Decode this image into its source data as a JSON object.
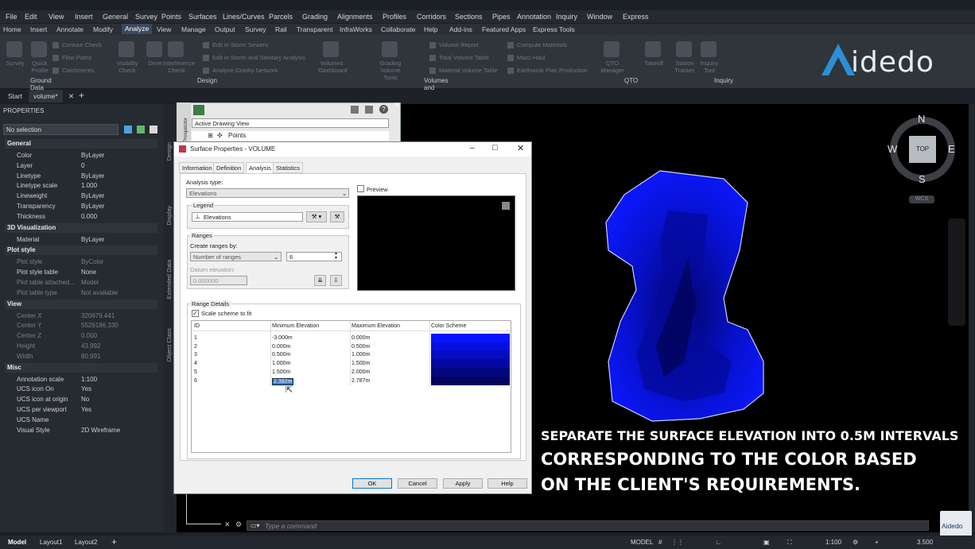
{
  "menu": [
    "File",
    "Edit",
    "View",
    "Insert",
    "General",
    "Survey",
    "Points",
    "Surfaces",
    "Lines/Curves",
    "Parcels",
    "Grading",
    "Alignments",
    "Profiles",
    "Corridors",
    "Sections",
    "Pipes",
    "Annotation",
    "Inquiry",
    "Window",
    "Express"
  ],
  "ribbon_tabs": [
    "Home",
    "Insert",
    "Annotate",
    "Modify",
    "Analyze",
    "View",
    "Manage",
    "Output",
    "Survey",
    "Rail",
    "Transparent",
    "InfraWorks",
    "Collaborate",
    "Help",
    "Add-ins",
    "Featured Apps",
    "Express Tools"
  ],
  "ribbon": {
    "big": [
      "Survey",
      "Quick Profile",
      "Visibility Check",
      "Drive",
      "Interference Check",
      "Volumes Dashboard",
      "Grading Volume Tools",
      "QTO Manager",
      "Takeoff",
      "Station Tracker",
      "Inquiry Tool"
    ],
    "small": [
      "Contour Check",
      "Flow Paths",
      "Catchments",
      "Edit in Storm Sewers",
      "Edit in Storm and Sanitary Analysis",
      "Analyze Gravity Network",
      "Volume Report",
      "Total Volume Table",
      "Material Volume Table",
      "Compute Materials",
      "Mass Haul",
      "Earthwork Plan Production"
    ],
    "groups": [
      "Ground Data",
      "Design",
      "Volumes and Materials",
      "QTO",
      "Inquiry"
    ]
  },
  "logo": "idedo",
  "doc_tabs": [
    "Start",
    "volume*"
  ],
  "properties": {
    "title": "PROPERTIES",
    "selection": "No selection",
    "sections": {
      "general": "General",
      "viz": "3D Visualization",
      "plot": "Plot style",
      "view": "View",
      "misc": "Misc"
    },
    "general": [
      [
        "Color",
        "ByLayer"
      ],
      [
        "Layer",
        "0"
      ],
      [
        "Linetype",
        "ByLayer"
      ],
      [
        "Linetype scale",
        "1.000"
      ],
      [
        "Lineweight",
        "ByLayer"
      ],
      [
        "Transparency",
        "ByLayer"
      ],
      [
        "Thickness",
        "0.000"
      ]
    ],
    "viz": [
      [
        "Material",
        "ByLayer"
      ]
    ],
    "plot": [
      [
        "Plot style",
        "ByColor"
      ],
      [
        "Plot style table",
        "None"
      ],
      [
        "Plot table attached...",
        "Model"
      ],
      [
        "Plot table type",
        "Not available"
      ]
    ],
    "view": [
      [
        "Center X",
        "320679.441"
      ],
      [
        "Center Y",
        "5526186.330"
      ],
      [
        "Center Z",
        "0.000"
      ],
      [
        "Height",
        "43.992"
      ],
      [
        "Width",
        "80.991"
      ]
    ],
    "misc": [
      [
        "Annotation scale",
        "1:100"
      ],
      [
        "UCS icon On",
        "Yes"
      ],
      [
        "UCS icon at origin",
        "No"
      ],
      [
        "UCS per viewport",
        "Yes"
      ],
      [
        "UCS Name",
        ""
      ],
      [
        "Visual Style",
        "2D Wireframe"
      ]
    ]
  },
  "side_tabs": [
    "Design",
    "Display",
    "Extended Data",
    "Object Class"
  ],
  "toolspace": {
    "view": "Active Drawing View",
    "item": "Points",
    "side": "Prospector"
  },
  "dialog": {
    "title": "Surface Properties - VOLUME",
    "tabs": [
      "Information",
      "Definition",
      "Analysis",
      "Statistics"
    ],
    "analysis_type_label": "Analysis type:",
    "analysis_type": "Elevations",
    "legend_label": "Legend",
    "legend": "Elevations",
    "preview": "Preview",
    "ranges_label": "Ranges",
    "create_by_label": "Create ranges by:",
    "create_by": "Number of ranges",
    "num_ranges": "6",
    "datum_label": "Datum elevation:",
    "datum": "0.000000",
    "details_label": "Range Details",
    "scale_scheme": "Scale scheme to fit",
    "columns": [
      "ID",
      "Minimum Elevation",
      "Maximum Elevation",
      "Color Scheme"
    ],
    "rows": [
      [
        "1",
        "-3.000m",
        "0.000m"
      ],
      [
        "2",
        "0.000m",
        "0.500m"
      ],
      [
        "3",
        "0.500m",
        "1.000m"
      ],
      [
        "4",
        "1.000m",
        "1.500m"
      ],
      [
        "5",
        "1.500m",
        "2.000m"
      ],
      [
        "6",
        "2.392m",
        "2.787m"
      ]
    ],
    "buttons": [
      "OK",
      "Cancel",
      "Apply",
      "Help"
    ]
  },
  "colors": {
    "scheme": [
      "#0a14ff",
      "#0810e0",
      "#060cc0",
      "#0508a0",
      "#040680",
      "#030460"
    ]
  },
  "viewcube": {
    "n": "N",
    "s": "S",
    "e": "E",
    "w": "W",
    "face": "TOP",
    "wcs": "WCS"
  },
  "caption": [
    "SEPARATE THE SURFACE ELEVATION INTO 0.5M INTERVALS",
    "CORRESPONDING TO THE COLOR BASED",
    "ON THE CLIENT'S REQUIREMENTS."
  ],
  "command_placeholder": "Type a command",
  "status": {
    "model_tab": "Model",
    "layouts": [
      "Layout1",
      "Layout2"
    ],
    "mode": "MODEL",
    "scale": "1:100",
    "value": "3.500"
  },
  "watermark": "Aidedo"
}
